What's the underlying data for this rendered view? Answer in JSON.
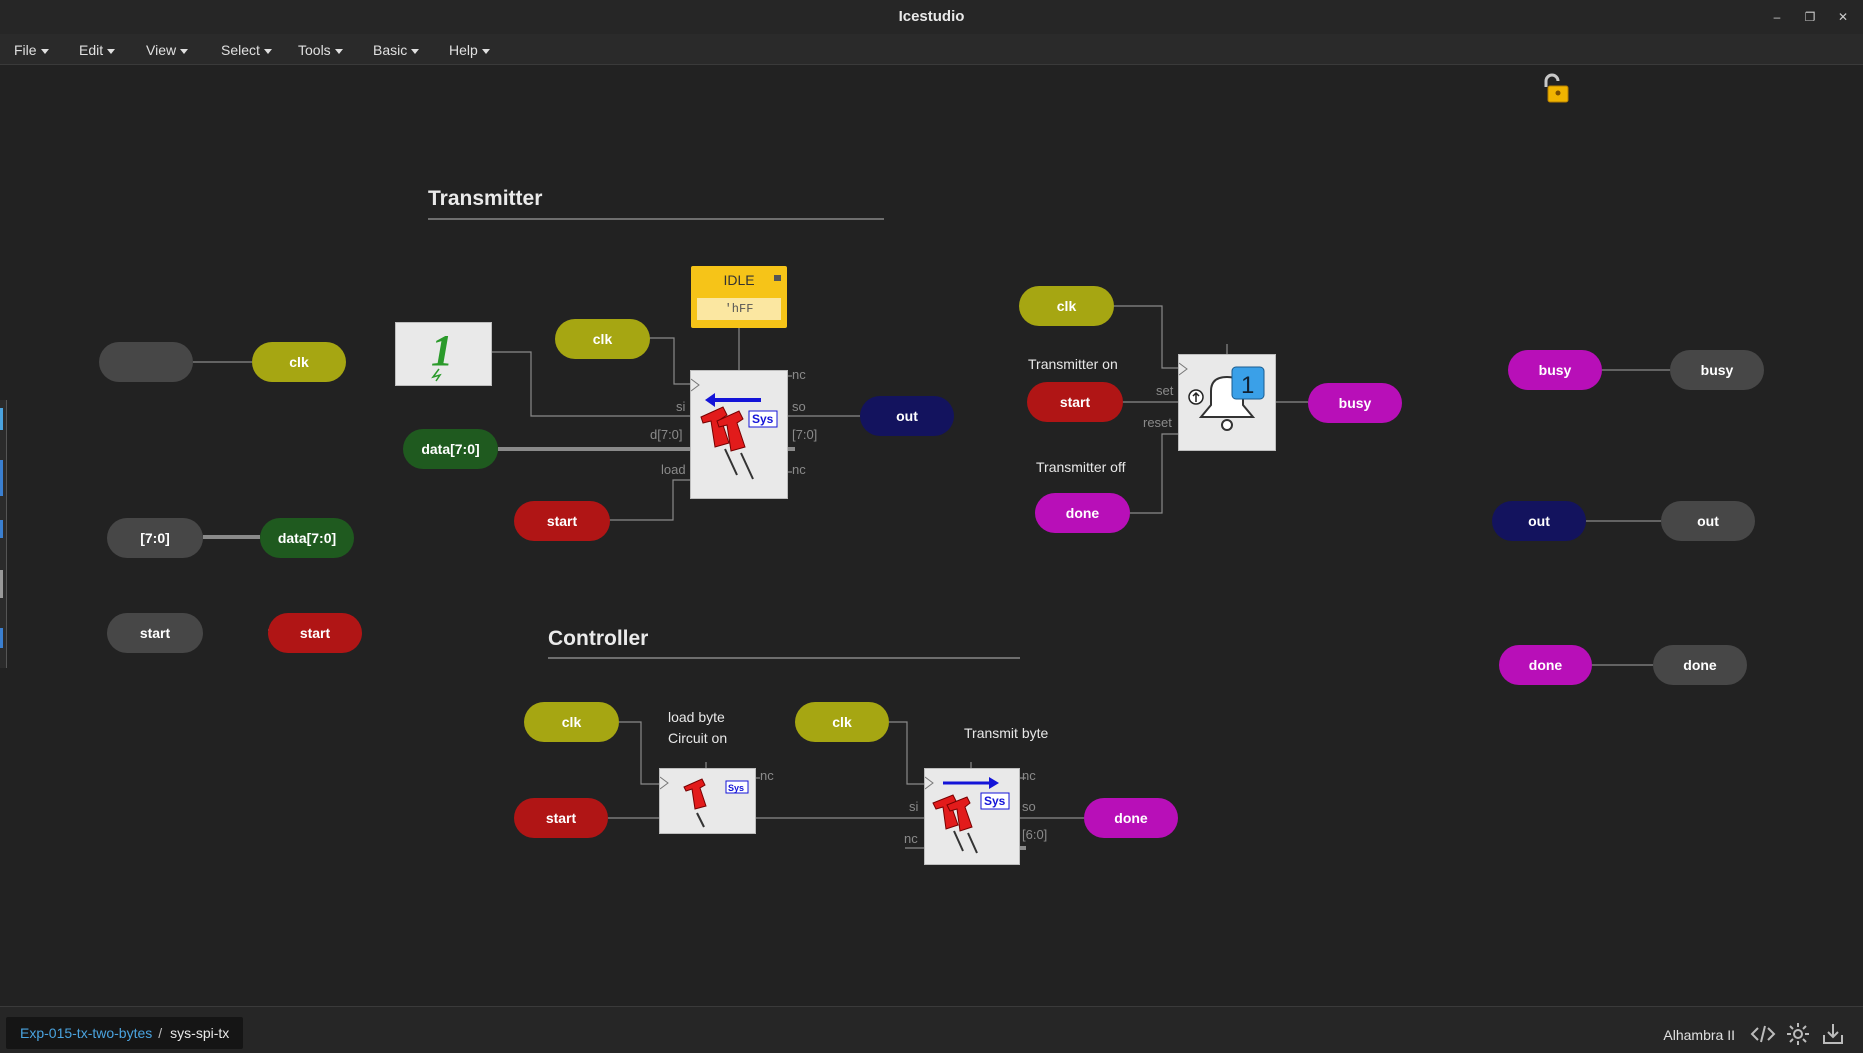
{
  "window": {
    "title": "Icestudio"
  },
  "menu": [
    "File",
    "Edit",
    "View",
    "Select",
    "Tools",
    "Basic",
    "Help"
  ],
  "sections": {
    "transmitter": "Transmitter",
    "controller": "Controller"
  },
  "labels": {
    "idle_name": "IDLE",
    "idle_value": "'hFF",
    "transmitter_on": "Transmitter on",
    "transmitter_off": "Transmitter off",
    "load_byte": "load byte",
    "circuit_on": "Circuit on",
    "transmit_byte": "Transmit byte",
    "const_one": "1"
  },
  "pills": {
    "clk": "clk",
    "data": "data[7:0]",
    "range": "[7:0]",
    "start": "start",
    "out": "out",
    "busy": "busy",
    "done": "done"
  },
  "ports": {
    "si": "si",
    "so": "so",
    "nc": "nc",
    "d": "d[7:0]",
    "load": "load",
    "q": "[7:0]",
    "set": "set",
    "reset": "reset",
    "q6": "[6:0]",
    "sys": "Sys",
    "bit1": "1"
  },
  "breadcrumb": {
    "project": "Exp-015-tx-two-bytes",
    "separator": "/",
    "current": "sys-spi-tx"
  },
  "board": "Alhambra II",
  "colors": {
    "clk": "#a6a612",
    "data": "#1f5a1f",
    "start": "#b01515",
    "out": "#13135e",
    "busy": "#b80fb8",
    "generic": "#474747",
    "idle": "#f6c418"
  }
}
